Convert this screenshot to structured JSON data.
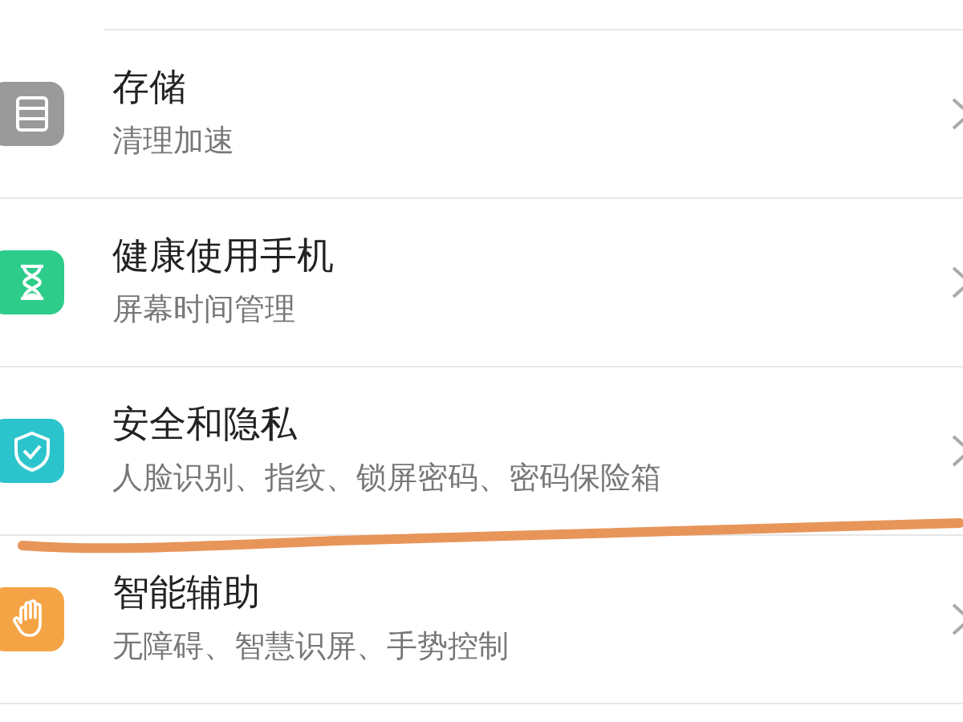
{
  "settings_items": [
    {
      "kind": "storage",
      "color": "#9a9a9a",
      "title": "存储",
      "subtitle": "清理加速"
    },
    {
      "kind": "hourglass",
      "color": "#2ecc8a",
      "title": "健康使用手机",
      "subtitle": "屏幕时间管理"
    },
    {
      "kind": "shield",
      "color": "#2cc4cc",
      "title": "安全和隐私",
      "subtitle": "人脸识别、指纹、锁屏密码、密码保险箱"
    },
    {
      "kind": "hand",
      "color": "#f5a445",
      "title": "智能辅助",
      "subtitle": "无障碍、智慧识屏、手势控制"
    }
  ]
}
